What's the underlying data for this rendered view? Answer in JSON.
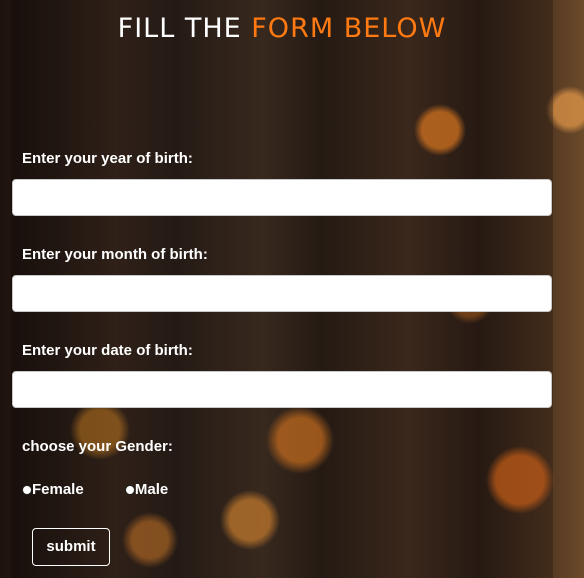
{
  "page": {
    "title_white": "FILL THE",
    "title_orange": "FORM BELOW"
  },
  "form": {
    "year_label": "Enter your year of birth:",
    "month_label": "Enter your month of birth:",
    "date_label": "Enter your date of birth:",
    "gender_label": "choose your Gender:",
    "gender_options": [
      "Female",
      "Male"
    ],
    "submit_label": "submit"
  },
  "colors": {
    "title_white": "#ffffff",
    "title_orange": "#ff7a12",
    "label": "#ffffff"
  }
}
